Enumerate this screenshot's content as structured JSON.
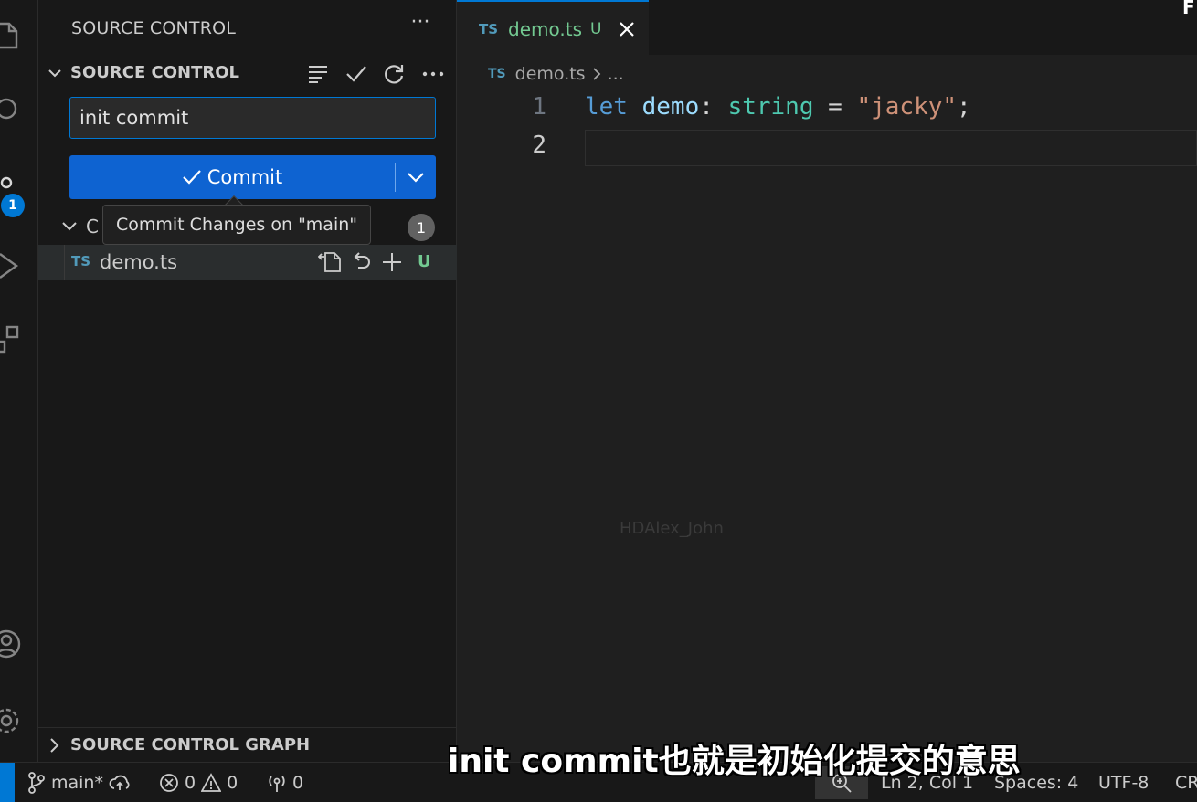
{
  "sidebar": {
    "title": "SOURCE CONTROL",
    "section_label": "SOURCE CONTROL",
    "commit_message_value": "init commit",
    "commit_button_label": "Commit",
    "tooltip": "Commit Changes on \"main\"",
    "changes_label": "C",
    "changes_count": "1",
    "file": {
      "type_badge": "TS",
      "name": "demo.ts",
      "status": "U"
    },
    "graph_label": "SOURCE CONTROL GRAPH"
  },
  "activity_bar": {
    "badge": "1",
    "icons": [
      "explorer-icon",
      "search-icon",
      "source-control-icon",
      "run-debug-icon",
      "extensions-icon",
      "account-icon",
      "settings-gear-icon"
    ]
  },
  "editor": {
    "tab": {
      "type_badge": "TS",
      "name": "demo.ts",
      "status": "U"
    },
    "breadcrumb": {
      "type_badge": "TS",
      "file": "demo.ts",
      "more": "..."
    },
    "line_numbers": [
      "1",
      "2"
    ],
    "code": {
      "kw": "let",
      "var": "demo",
      "colon": ":",
      "type": "string",
      "eq": "=",
      "str": "\"jacky\"",
      "semi": ";"
    },
    "watermark": "HDAlex_John",
    "corner_mark": "F"
  },
  "statusbar": {
    "branch": "main*",
    "errors": "0",
    "warnings": "0",
    "ports": "0",
    "position": "Ln 2, Col 1",
    "spaces": "Spaces: 4",
    "encoding": "UTF-8",
    "eol": "CR"
  },
  "overlay_subtitle": "init commit也就是初始化提交的意思",
  "colors": {
    "accent": "#0078d4",
    "commit_button": "#0e63d1",
    "untracked": "#73c991",
    "ts_badge": "#519aba"
  }
}
